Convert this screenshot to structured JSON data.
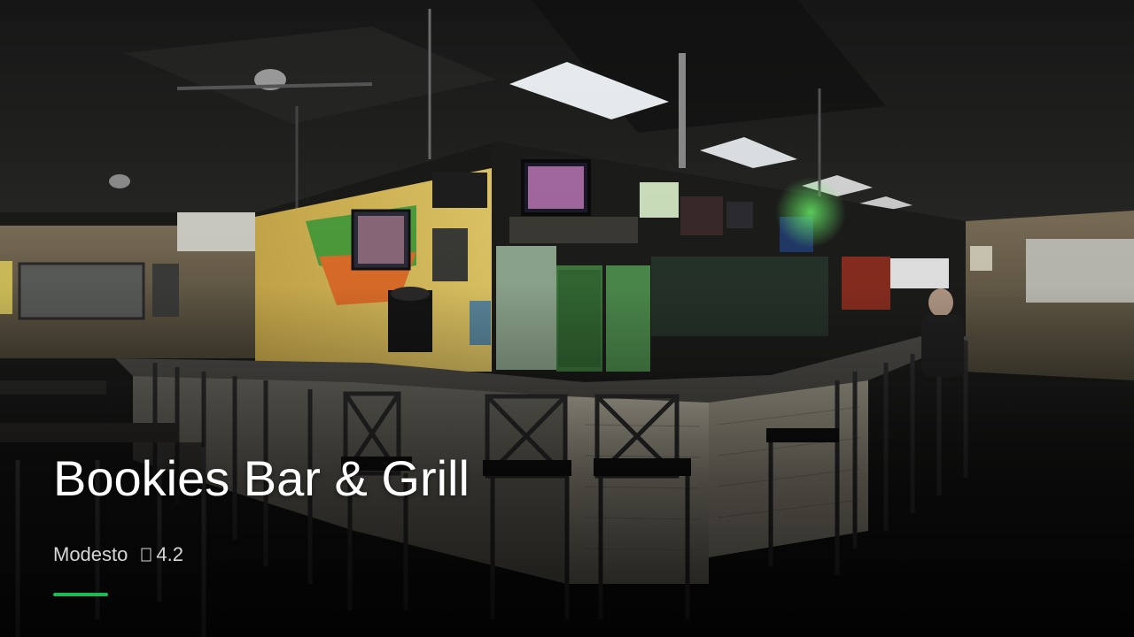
{
  "venue": {
    "name": "Bookies Bar & Grill",
    "city": "Modesto",
    "rating": "4.2"
  },
  "icons": {
    "rating": "star-icon"
  },
  "colors": {
    "accent": "#1db954",
    "title_text": "#ffffff",
    "meta_text": "#d6d6d6"
  }
}
